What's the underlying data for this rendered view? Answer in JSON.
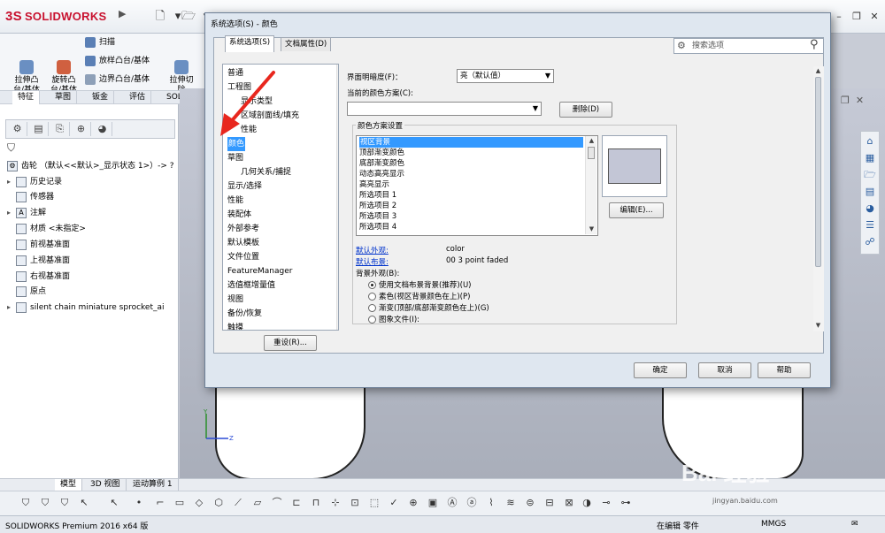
{
  "app": {
    "logo_text": "SOLIDWORKS",
    "logo_mark": "3S",
    "title_arrow": "▶"
  },
  "ribbon": {
    "extrude_boss": "拉伸凸\n台/基体",
    "revolve_boss": "旋转凸\n台/基体",
    "sweep": "扫描",
    "loft": "放样凸台/基体",
    "boundary": "边界凸台/基体",
    "extrude_cut": "拉伸切\n除"
  },
  "command_tabs": [
    "特征",
    "草图",
    "钣金",
    "评估",
    "SOLIDW"
  ],
  "feature_tree": {
    "root": "齿轮 （默认<<默认>_显示状态 1>）-> ?",
    "items": [
      {
        "label": "历史记录",
        "expand": "▸"
      },
      {
        "label": "传感器",
        "expand": ""
      },
      {
        "label": "注解",
        "expand": "▸"
      },
      {
        "label": "材质 <未指定>",
        "expand": ""
      },
      {
        "label": "前视基准面",
        "expand": ""
      },
      {
        "label": "上视基准面",
        "expand": ""
      },
      {
        "label": "右视基准面",
        "expand": ""
      },
      {
        "label": "原点",
        "expand": ""
      },
      {
        "label": "silent chain miniature sprocket_ai",
        "expand": "▸"
      }
    ]
  },
  "dialog": {
    "title": "系统选项(S) - 颜色",
    "tabs": [
      "系统选项(S)",
      "文档属性(D)"
    ],
    "search_placeholder": "搜索选项",
    "nav_items": [
      "普通",
      "工程图",
      "显示类型",
      "区域剖面线/填充",
      "性能",
      "颜色",
      "草图",
      "几何关系/捕捉",
      "显示/选择",
      "性能",
      "装配体",
      "外部参考",
      "默认模板",
      "文件位置",
      "FeatureManager",
      "选值框增量值",
      "视图",
      "备份/恢复",
      "触摸"
    ],
    "selected_nav": "颜色",
    "ui_brightness_label": "界面明暗度(F)：",
    "ui_brightness_value": "亮（默认值）",
    "current_scheme_label": "当前的颜色方案(C):",
    "current_scheme_value": "",
    "delete_button": "删除(D)",
    "scheme_settings_label": "颜色方案设置",
    "scheme_items": [
      "视区背景",
      "顶部渐变颜色",
      "底部渐变颜色",
      "动态高亮显示",
      "高亮显示",
      "所选项目 1",
      "所选项目 2",
      "所选项目 3",
      "所选项目 4"
    ],
    "swatch_color": "#c3c6d6",
    "edit_button": "编辑(E)...",
    "default_appearance_label": "默认外观:",
    "default_appearance_value": "color",
    "default_scene_label": "默认布景:",
    "default_scene_value": "00 3 point faded",
    "background_label": "背景外观(B):",
    "background_options": [
      "使用文档布景背景(推荐)(U)",
      "素色(视区背景颜色在上)(P)",
      "渐变(顶部/底部渐变颜色在上)(G)",
      "图象文件(I):"
    ],
    "reset_button": "重设(R)...",
    "ok_button": "确定",
    "cancel_button": "取消",
    "help_button": "帮助"
  },
  "bottom_tabs": [
    "模型",
    "3D 视图",
    "运动算例 1"
  ],
  "status": {
    "product": "SOLIDWORKS Premium 2016 x64 版",
    "editing": "在编辑 零件",
    "units": "MMGS"
  },
  "watermark": {
    "main": "Bai 经验",
    "sub": "jingyan.baidu.com"
  },
  "colors": {
    "selection": "#3399ff",
    "logo": "#c8102e",
    "annotation_arrow": "#e8271e"
  }
}
